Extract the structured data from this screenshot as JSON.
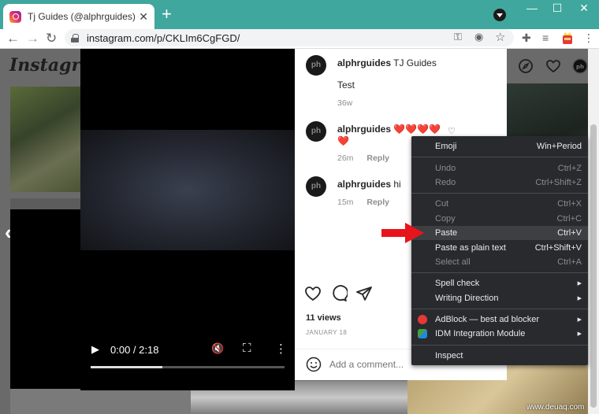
{
  "browser": {
    "tab_title": "Tj Guides (@alphrguides) • Insta",
    "tab_close": "✕",
    "new_tab": "+",
    "window_minimize": "—",
    "window_maximize": "☐",
    "window_close": "✕",
    "back": "←",
    "forward": "→",
    "reload": "↻",
    "url": "instagram.com/p/CKLIm6CgFGD/",
    "key_icon": "⚿",
    "eye_off_icon": "◉",
    "star_icon": "☆",
    "puzzle_icon": "✚",
    "queue_icon": "≡",
    "menu_icon": "⋮"
  },
  "instagram": {
    "logo": "Instagram",
    "prev": "‹",
    "next": "›"
  },
  "video": {
    "play": "▶",
    "time": "0:00 / 2:18",
    "progress_fraction": 0.37,
    "mute": "🔇",
    "fullscreen": "⛶",
    "more": "⋮"
  },
  "comments": [
    {
      "avatar": "ph",
      "user": "alphrguides",
      "text": "TJ Guides",
      "subtext": "Test",
      "time": "36w",
      "reply": ""
    },
    {
      "avatar": "ph",
      "user": "alphrguides",
      "text": "❤️❤️❤️❤️❤️",
      "subtext": "",
      "time": "26m",
      "reply": "Reply"
    },
    {
      "avatar": "ph",
      "user": "alphrguides",
      "text": "hi",
      "subtext": "",
      "time": "15m",
      "reply": "Reply"
    }
  ],
  "post": {
    "views": "11 views",
    "date": "JANUARY 18",
    "add_comment_placeholder": "Add a comment..."
  },
  "context_menu": {
    "emoji": {
      "label": "Emoji",
      "shortcut": "Win+Period"
    },
    "undo": {
      "label": "Undo",
      "shortcut": "Ctrl+Z"
    },
    "redo": {
      "label": "Redo",
      "shortcut": "Ctrl+Shift+Z"
    },
    "cut": {
      "label": "Cut",
      "shortcut": "Ctrl+X"
    },
    "copy": {
      "label": "Copy",
      "shortcut": "Ctrl+C"
    },
    "paste": {
      "label": "Paste",
      "shortcut": "Ctrl+V"
    },
    "paste_plain": {
      "label": "Paste as plain text",
      "shortcut": "Ctrl+Shift+V"
    },
    "select_all": {
      "label": "Select all",
      "shortcut": "Ctrl+A"
    },
    "spell_check": {
      "label": "Spell check",
      "submenu": "▶"
    },
    "writing_direction": {
      "label": "Writing Direction",
      "submenu": "▶"
    },
    "adblock": {
      "label": "AdBlock — best ad blocker",
      "submenu": "▶"
    },
    "idm": {
      "label": "IDM Integration Module",
      "submenu": "▶"
    },
    "inspect": {
      "label": "Inspect"
    }
  },
  "watermark": "www.deuaq.com",
  "colors": {
    "tabbar": "#3fa79d",
    "menu_bg": "#292a2d",
    "heart": "#e0263a",
    "arrow": "#e8141b"
  }
}
